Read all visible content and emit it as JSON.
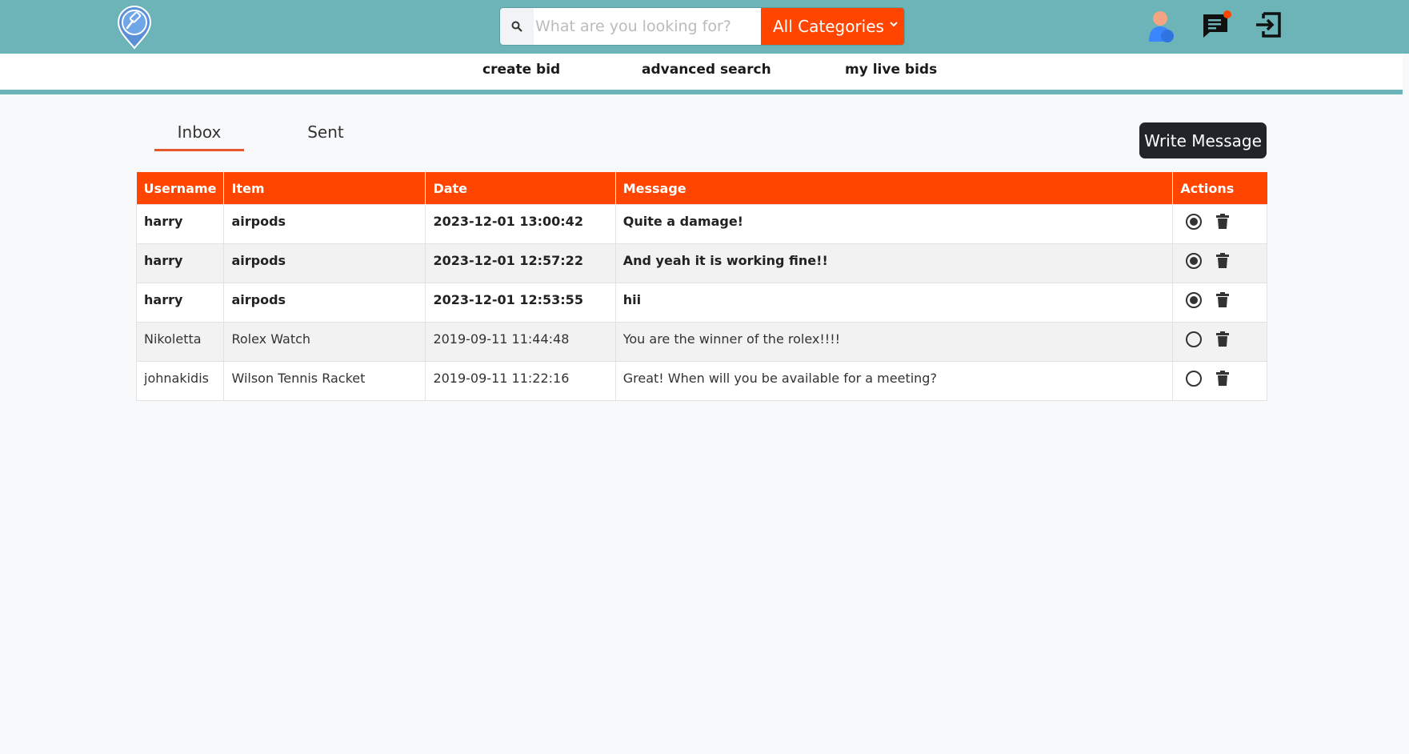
{
  "header": {
    "search": {
      "placeholder": "What are you looking for?",
      "value": ""
    },
    "category": {
      "selected": "All Categories"
    },
    "icons": [
      "gavel-logo-icon",
      "user-icon",
      "chat-icon",
      "logout-icon"
    ]
  },
  "nav": {
    "links": [
      "create bid",
      "advanced search",
      "my live bids"
    ]
  },
  "tabs": {
    "inbox": "Inbox",
    "sent": "Sent",
    "active": "Inbox"
  },
  "write_message": "Write Message",
  "table": {
    "headers": [
      "Username",
      "Item",
      "Date",
      "Message",
      "Actions"
    ],
    "rows": [
      {
        "username": "harry",
        "item": "airpods",
        "date": "2023-12-01 13:00:42",
        "message": "Quite a damage!",
        "read": false
      },
      {
        "username": "harry",
        "item": "airpods",
        "date": "2023-12-01 12:57:22",
        "message": "And yeah it is working fine!!",
        "read": false
      },
      {
        "username": "harry",
        "item": "airpods",
        "date": "2023-12-01 12:53:55",
        "message": "hii",
        "read": false
      },
      {
        "username": "Nikoletta",
        "item": "Rolex Watch",
        "date": "2019-09-11 11:44:48",
        "message": "You are the winner of the rolex!!!!",
        "read": true
      },
      {
        "username": "johnakidis",
        "item": "Wilson Tennis Racket",
        "date": "2019-09-11 11:22:16",
        "message": "Great! When will you be available for a meeting?",
        "read": true
      }
    ]
  },
  "colors": {
    "header": "#6cb4b8",
    "accent": "#ff4500",
    "notification": "#ff4500",
    "button_dark": "#212529"
  }
}
